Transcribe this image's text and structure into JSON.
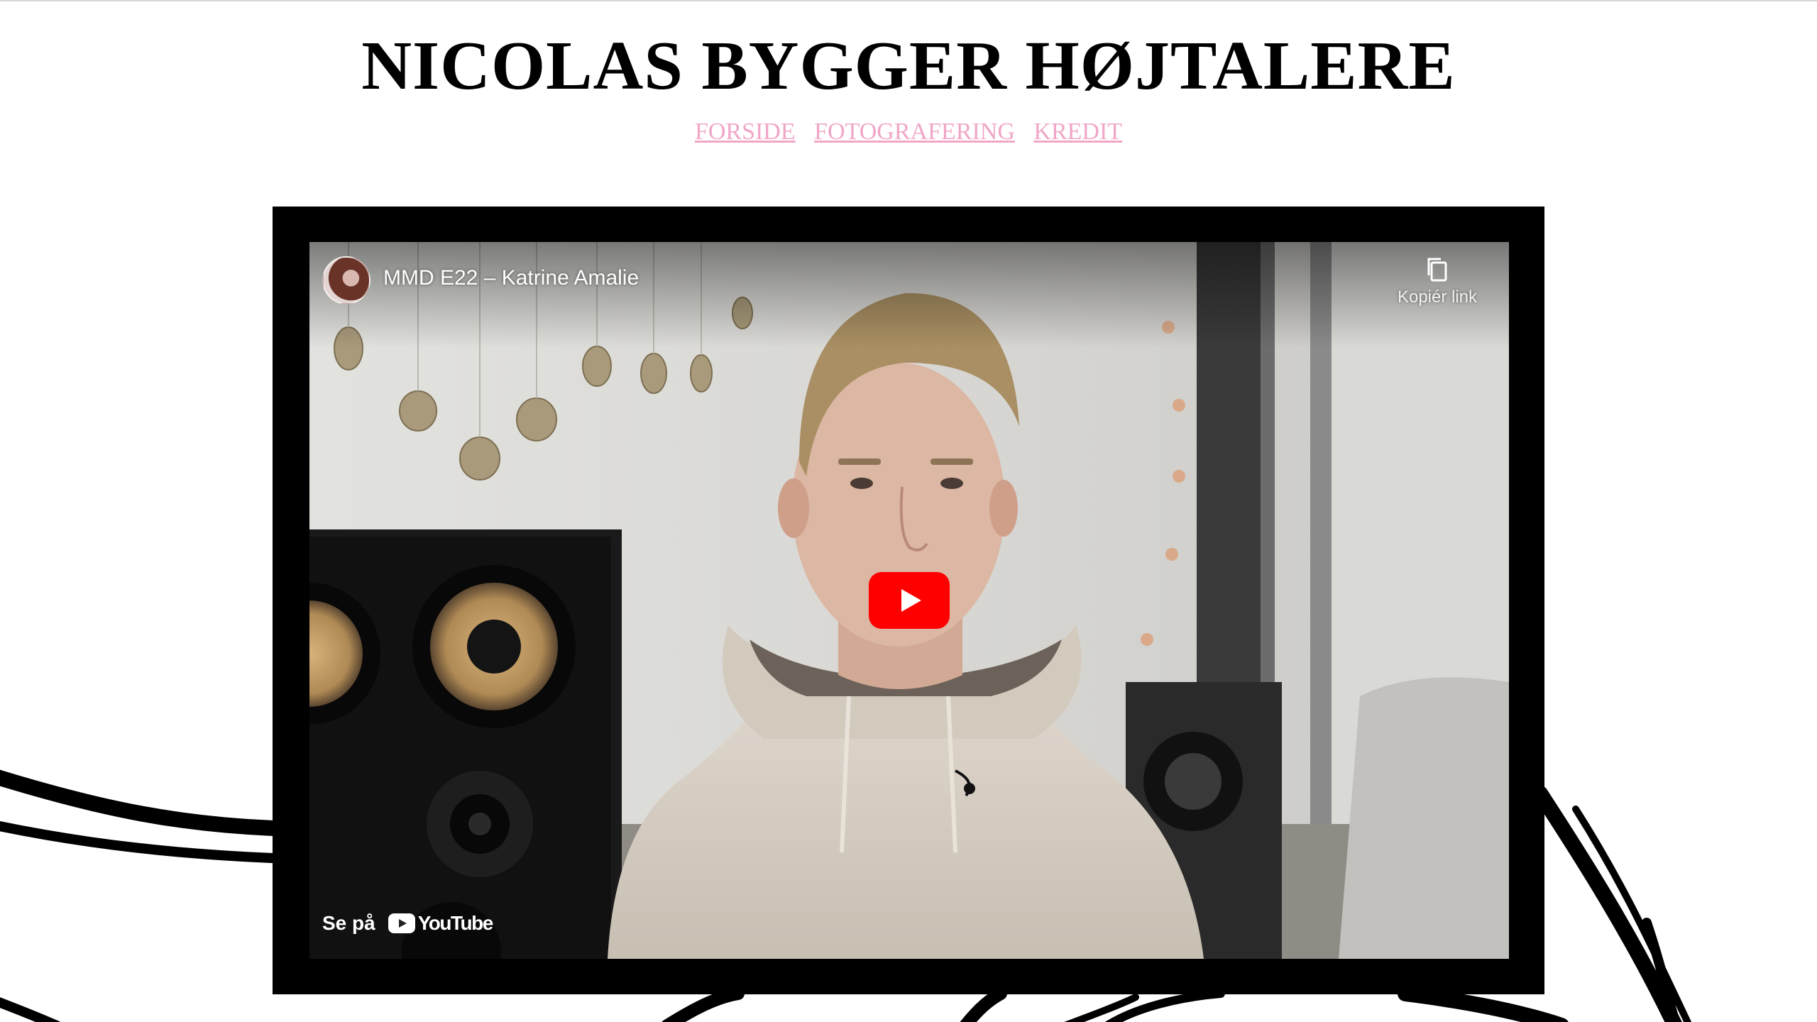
{
  "site": {
    "title": "NICOLAS BYGGER HØJTALERE"
  },
  "nav": {
    "items": [
      {
        "label": "FORSIDE"
      },
      {
        "label": "FOTOGRAFERING"
      },
      {
        "label": "KREDIT"
      }
    ],
    "link_color": "#f0a6c8"
  },
  "video": {
    "title": "MMD E22 – Katrine Amalie",
    "copy_link_label": "Kopiér link",
    "watch_on_label": "Se på",
    "platform_wordmark": "YouTube",
    "play_button_color": "#ff0000",
    "frame_color": "#000000",
    "icons": {
      "avatar": "channel-avatar",
      "copy": "copy-icon",
      "play": "play-icon",
      "logo": "youtube-logo-icon"
    }
  }
}
